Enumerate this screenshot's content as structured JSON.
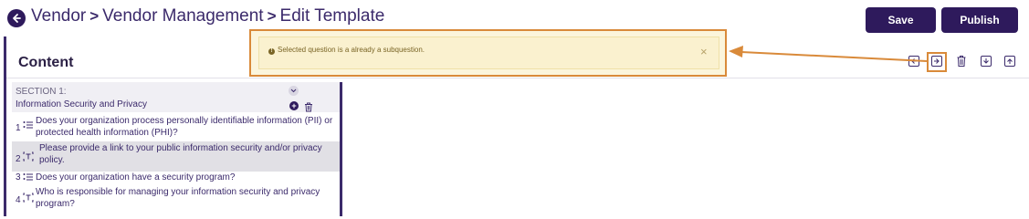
{
  "breadcrumb": {
    "items": [
      "Vendor",
      "Vendor Management",
      "Edit Template"
    ],
    "separator": ">"
  },
  "header": {
    "save_label": "Save",
    "publish_label": "Publish"
  },
  "content": {
    "title": "Content"
  },
  "toolbar": {
    "icons": [
      "outdent-icon",
      "indent-icon",
      "trash-icon",
      "move-down-icon",
      "move-up-icon"
    ]
  },
  "section": {
    "label": "SECTION 1:",
    "name": "Information Security and Privacy"
  },
  "questions": [
    {
      "number": "1",
      "icon": "multiple-choice-icon",
      "text": "Does your organization process personally identifiable information (PII) or protected health information (PHI)?"
    },
    {
      "number": "2",
      "icon": "text-question-icon",
      "text": "Please provide a link to your public information security and/or privacy policy."
    },
    {
      "number": "3",
      "icon": "multiple-choice-icon",
      "text": "Does your organization have a security program?"
    },
    {
      "number": "4",
      "icon": "text-question-icon",
      "text": "Who is responsible for managing your information security and privacy program?"
    }
  ],
  "toast": {
    "message": "Selected question is a already a subquestion.",
    "close": "×"
  },
  "colors": {
    "primary": "#2e1a5c",
    "annotation": "#d98a3a",
    "toast_bg": "#fbf5dc",
    "selected_row": "#e1e0e5"
  }
}
